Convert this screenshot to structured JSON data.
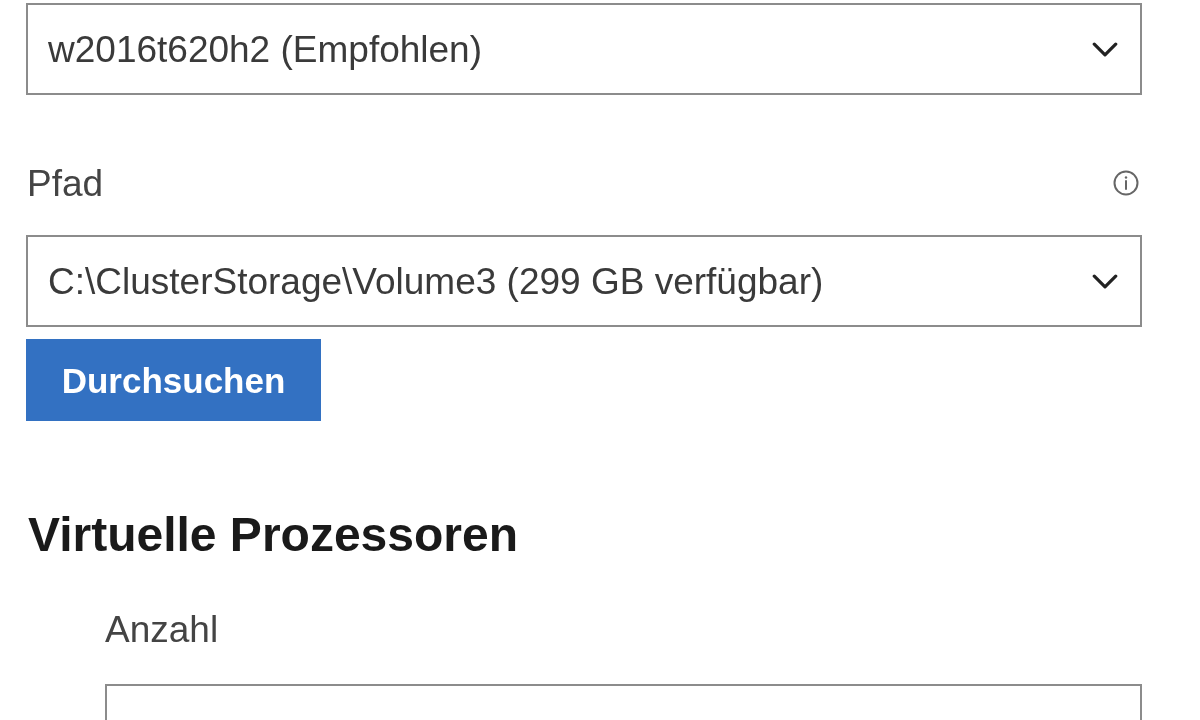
{
  "machine_select": {
    "value": "w2016t620h2 (Empfohlen)"
  },
  "path": {
    "label": "Pfad",
    "select": {
      "value": "C:\\ClusterStorage\\Volume3 (299 GB verfügbar)"
    },
    "browse_button": "Durchsuchen"
  },
  "virtual_processors": {
    "heading": "Virtuelle Prozessoren",
    "count": {
      "label": "Anzahl"
    }
  }
}
